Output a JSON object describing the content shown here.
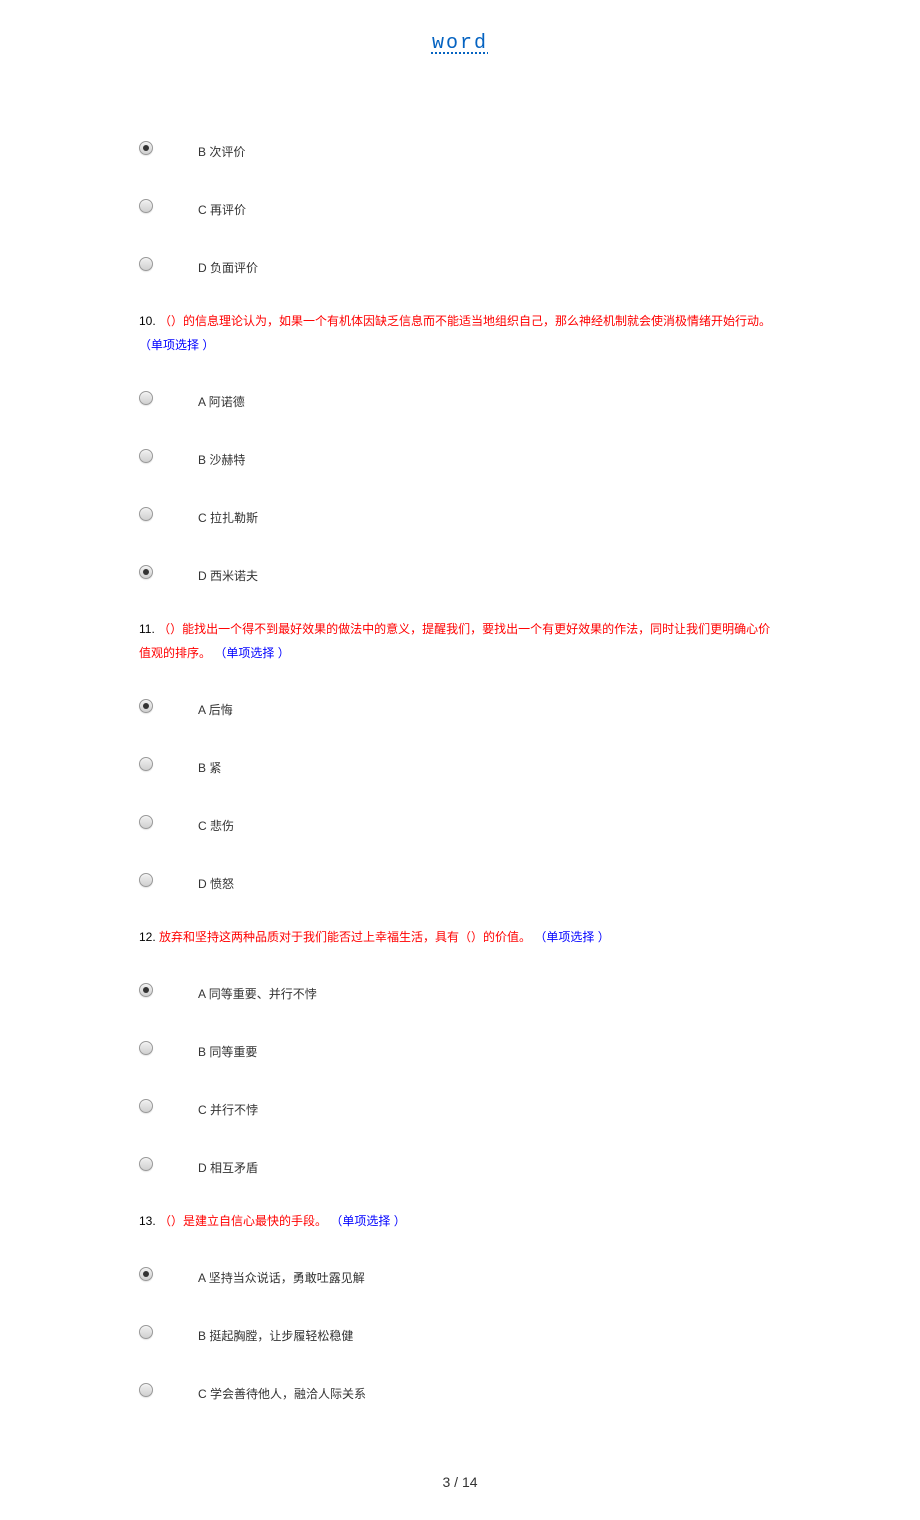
{
  "header": {
    "link_text": "word"
  },
  "partial_options_q9": [
    {
      "letter": "B",
      "text": "次评价",
      "selected": true
    },
    {
      "letter": "C",
      "text": "再评价",
      "selected": false
    },
    {
      "letter": "D",
      "text": "负面评价",
      "selected": false
    }
  ],
  "questions": [
    {
      "number": "10.",
      "body": "（）的信息理论认为，如果一个有机体因缺乏信息而不能适当地组织自己，那么神经机制就会使消极情绪开始行动。",
      "type": "（单项选择 ）",
      "options": [
        {
          "letter": "A",
          "text": "阿诺德",
          "selected": false
        },
        {
          "letter": "B",
          "text": "沙赫特",
          "selected": false
        },
        {
          "letter": "C",
          "text": "拉扎勒斯",
          "selected": false
        },
        {
          "letter": "D",
          "text": "西米诺夫",
          "selected": true
        }
      ]
    },
    {
      "number": "11.",
      "body": "（）能找出一个得不到最好效果的做法中的意义，提醒我们，要找出一个有更好效果的作法，同时让我们更明确心价值观的排序。",
      "type": "（单项选择 ）",
      "options": [
        {
          "letter": "A",
          "text": "后悔",
          "selected": true
        },
        {
          "letter": "B",
          "text": "紧",
          "selected": false
        },
        {
          "letter": "C",
          "text": "悲伤",
          "selected": false
        },
        {
          "letter": "D",
          "text": "愤怒",
          "selected": false
        }
      ]
    },
    {
      "number": "12.",
      "body": "放弃和坚持这两种品质对于我们能否过上幸福生活，具有（）的价值。",
      "type": "（单项选择 ）",
      "options": [
        {
          "letter": "A",
          "text": "同等重要、并行不悖",
          "selected": true
        },
        {
          "letter": "B",
          "text": "同等重要",
          "selected": false
        },
        {
          "letter": "C",
          "text": "并行不悖",
          "selected": false
        },
        {
          "letter": "D",
          "text": "相互矛盾",
          "selected": false
        }
      ]
    },
    {
      "number": "13.",
      "body": "（）是建立自信心最快的手段。",
      "type": "（单项选择 ）",
      "options": [
        {
          "letter": "A",
          "text": "坚持当众说话，勇敢吐露见解",
          "selected": true
        },
        {
          "letter": "B",
          "text": "挺起胸膛，让步履轻松稳健",
          "selected": false
        },
        {
          "letter": "C",
          "text": "学会善待他人，融洽人际关系",
          "selected": false
        }
      ]
    }
  ],
  "footer": {
    "page_current": "3",
    "page_sep": " / ",
    "page_total": "14"
  }
}
